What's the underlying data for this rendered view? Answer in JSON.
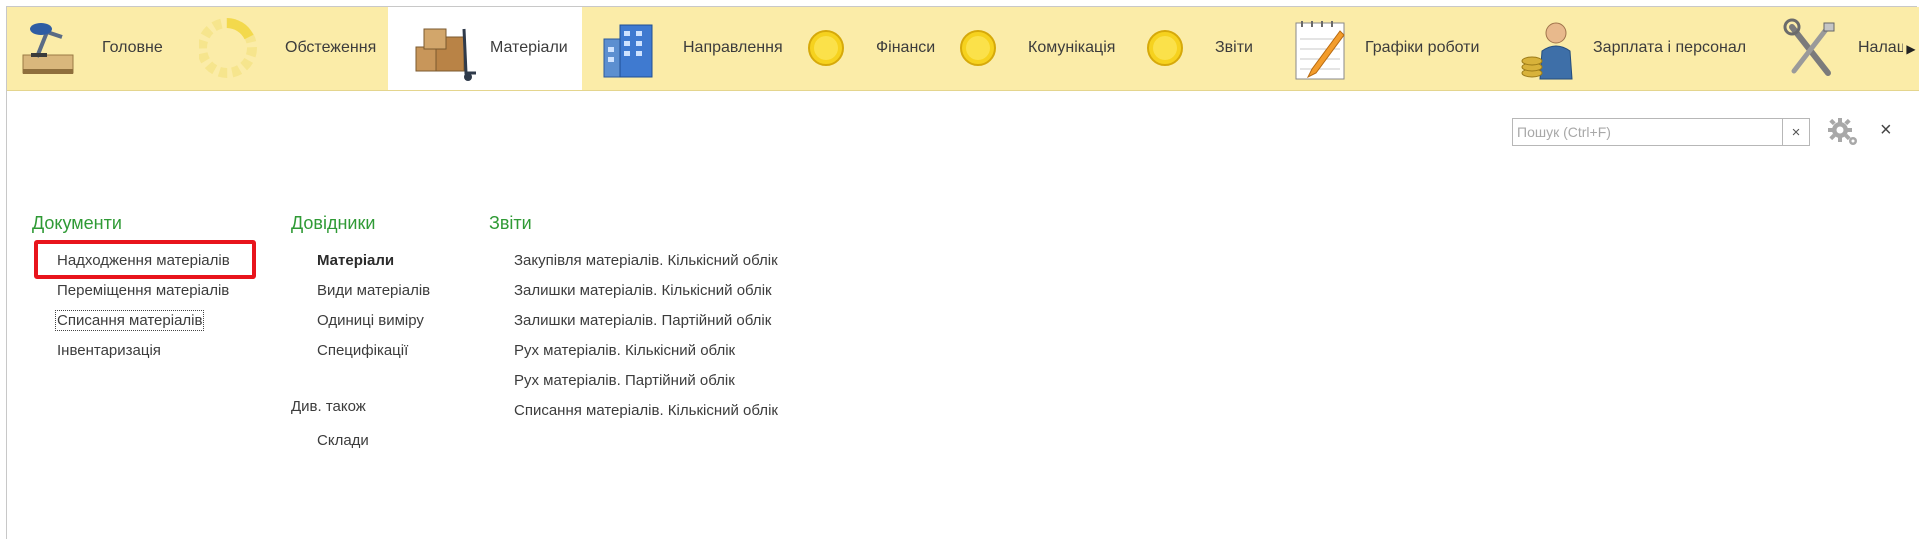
{
  "tabs": [
    {
      "label": "Головне",
      "icon": "desk-lamp-icon"
    },
    {
      "label": "Обстеження",
      "icon": "loading-circle-icon"
    },
    {
      "label": "Матеріали",
      "icon": "boxes-cart-icon",
      "active": true
    },
    {
      "label": "Направлення",
      "icon": "building-icon"
    },
    {
      "label": "Фінанси",
      "icon": "coin-icon"
    },
    {
      "label": "Комунікація",
      "icon": "coin-icon"
    },
    {
      "label": "Звіти",
      "icon": "coin-icon"
    },
    {
      "label": "Графіки роботи",
      "icon": "notepad-pencil-icon"
    },
    {
      "label": "Зарплата і персонал",
      "icon": "worker-coins-icon"
    },
    {
      "label": "Налаш",
      "icon": "tools-icon"
    }
  ],
  "search": {
    "placeholder": "Пошук (Ctrl+F)",
    "value": "",
    "clear": "×"
  },
  "close_label": "×",
  "sections": {
    "documents": {
      "title": "Документи",
      "items": [
        "Надходження матеріалів",
        "Переміщення матеріалів",
        "Списання матеріалів",
        "Інвентаризація"
      ]
    },
    "directories": {
      "title": "Довідники",
      "items": [
        "Матеріали",
        "Види матеріалів",
        "Одиниці виміру",
        "Специфікації"
      ],
      "see_also": "Див. також",
      "see_also_items": [
        "Склади"
      ]
    },
    "reports": {
      "title": "Звіти",
      "items": [
        "Закупівля матеріалів. Кількісний облік",
        "Залишки матеріалів. Кількісний облік",
        "Залишки матеріалів. Партійний облік",
        "Рух матеріалів. Кількісний облік",
        "Рух матеріалів. Партійний облік",
        "Списання матеріалів. Кількісний облік"
      ]
    }
  },
  "colors": {
    "topbar": "#fbeca8",
    "section_title": "#2f9a35",
    "highlight": "#e8141c"
  }
}
